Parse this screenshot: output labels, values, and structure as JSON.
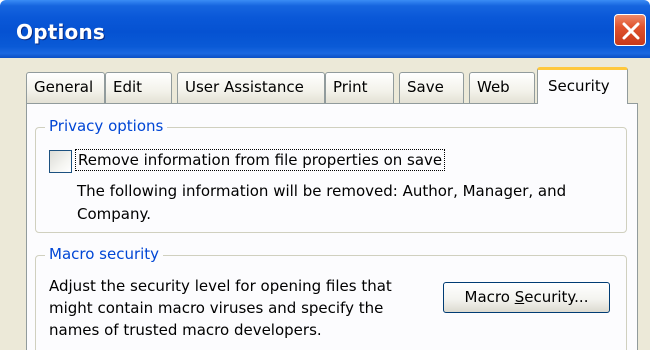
{
  "window": {
    "title": "Options",
    "close_icon": "close-icon"
  },
  "tabs": [
    {
      "label": "General",
      "active": false
    },
    {
      "label": "Edit",
      "active": false
    },
    {
      "label": "User Assistance",
      "active": false
    },
    {
      "label": "Print",
      "active": false
    },
    {
      "label": "Save",
      "active": false
    },
    {
      "label": "Web",
      "active": false
    },
    {
      "label": "Security",
      "active": true
    }
  ],
  "privacy": {
    "group_title": "Privacy options",
    "checkbox_label": "Remove information from file properties on save",
    "checkbox_checked": false,
    "info_line1": "The following information will be removed: Author, Manager, and",
    "info_line2": "Company."
  },
  "macro": {
    "group_title": "Macro security",
    "desc_line1": "Adjust the security level for opening files that",
    "desc_line2": "might contain macro viruses and specify the",
    "desc_line3": "names of trusted macro developers.",
    "button_prefix": "Macro ",
    "button_mnemonic": "S",
    "button_suffix": "ecurity..."
  },
  "colors": {
    "titlebar": "#0552d2",
    "dialog_bg": "#ece9d8",
    "group_title": "#0046d5",
    "active_tab_accent": "#ffc83c",
    "close_button": "#e0532e"
  }
}
